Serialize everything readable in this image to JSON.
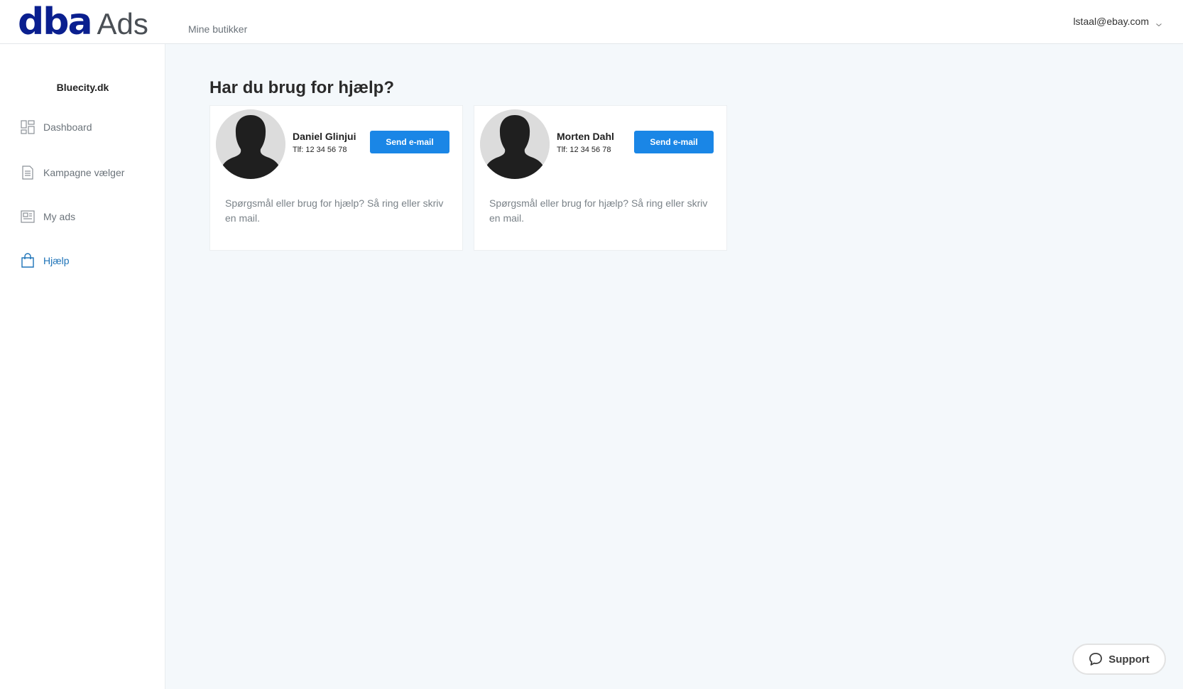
{
  "header": {
    "logo_primary": "dba",
    "logo_secondary": "Ads",
    "nav_link": "Mine butikker",
    "account_email": "lstaal@ebay.com"
  },
  "sidebar": {
    "shop_name": "Bluecity.dk",
    "items": [
      {
        "label": "Dashboard",
        "icon": "dashboard-icon",
        "active": false
      },
      {
        "label": "Kampagne vælger",
        "icon": "list-document-icon",
        "active": false
      },
      {
        "label": "My ads",
        "icon": "ads-grid-icon",
        "active": false
      },
      {
        "label": "Hjælp",
        "icon": "shopping-bag-icon",
        "active": true
      }
    ]
  },
  "main": {
    "title": "Har du brug for hjælp?",
    "contacts": [
      {
        "name": "Daniel Glinjui",
        "phone": "Tlf: 12 34 56 78",
        "button": "Send e-mail",
        "description": "Spørgsmål eller brug for hjælp? Så ring eller skriv en mail."
      },
      {
        "name": "Morten Dahl",
        "phone": "Tlf: 12 34 56 78",
        "button": "Send e-mail",
        "description": "Spørgsmål eller brug for hjælp? Så ring eller skriv en mail."
      }
    ]
  },
  "support": {
    "label": "Support",
    "icon": "chat-bubble-icon"
  },
  "colors": {
    "brand": "#0a1f8f",
    "accent": "#1a86e6",
    "active_nav": "#1d73b8",
    "background": "#f4f8fb"
  }
}
